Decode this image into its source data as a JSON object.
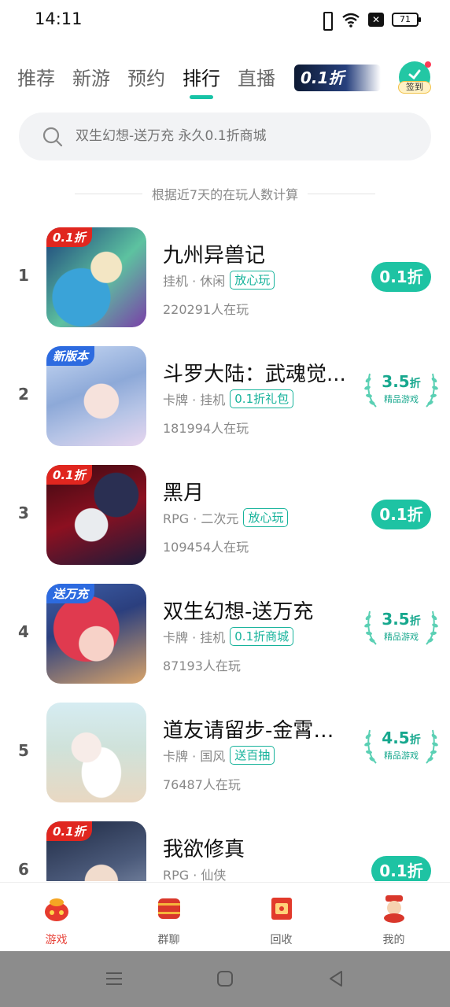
{
  "status_bar": {
    "time": "14:11",
    "battery": "71"
  },
  "tabs": [
    {
      "label": "推荐",
      "active": false
    },
    {
      "label": "新游",
      "active": false
    },
    {
      "label": "预约",
      "active": false
    },
    {
      "label": "排行",
      "active": true
    },
    {
      "label": "直播",
      "active": false
    }
  ],
  "promo_banner": {
    "text": "0.1折"
  },
  "signin": {
    "label": "签到"
  },
  "search": {
    "placeholder": "双生幻想-送万充 永久0.1折商城"
  },
  "ranking_note": "根据近7天的在玩人数计算",
  "games": [
    {
      "rank": "1",
      "title": "九州异兽记",
      "category": "挂机 · 休闲",
      "tag": "放心玩",
      "players": "220291人在玩",
      "badge": "0.1折",
      "badge_style": "red",
      "action": {
        "type": "button",
        "label": "0.1折"
      }
    },
    {
      "rank": "2",
      "title": "斗罗大陆：武魂觉...",
      "category": "卡牌 · 挂机",
      "tag": "0.1折礼包",
      "players": "181994人在玩",
      "badge": "新版本",
      "badge_style": "blue",
      "action": {
        "type": "quality",
        "value": "3.5",
        "unit": "折",
        "label": "精品游戏"
      }
    },
    {
      "rank": "3",
      "title": "黑月",
      "category": "RPG · 二次元",
      "tag": "放心玩",
      "players": "109454人在玩",
      "badge": "0.1折",
      "badge_style": "red",
      "action": {
        "type": "button",
        "label": "0.1折"
      }
    },
    {
      "rank": "4",
      "title": "双生幻想-送万充",
      "category": "卡牌 · 挂机",
      "tag": "0.1折商城",
      "players": "87193人在玩",
      "badge": "送万充",
      "badge_style": "blue",
      "action": {
        "type": "quality",
        "value": "3.5",
        "unit": "折",
        "label": "精品游戏"
      }
    },
    {
      "rank": "5",
      "title": "道友请留步-金霄破晓",
      "category": "卡牌 · 国风",
      "tag": "送百抽",
      "players": "76487人在玩",
      "badge": "",
      "badge_style": "none",
      "action": {
        "type": "quality",
        "value": "4.5",
        "unit": "折",
        "label": "精品游戏"
      }
    },
    {
      "rank": "6",
      "title": "我欲修真",
      "category": "RPG · 仙侠",
      "tag": "",
      "players": "",
      "badge": "0.1折",
      "badge_style": "red",
      "action": {
        "type": "button",
        "label": "0.1折"
      }
    }
  ],
  "bottom_nav": [
    {
      "label": "游戏",
      "active": true,
      "icon": "game-bag-icon"
    },
    {
      "label": "群聊",
      "active": false,
      "icon": "chat-drum-icon"
    },
    {
      "label": "回收",
      "active": false,
      "icon": "recycle-box-icon"
    },
    {
      "label": "我的",
      "active": false,
      "icon": "profile-mascot-icon"
    }
  ],
  "colors": {
    "accent": "#1ec3a3",
    "active_nav": "#e8453c"
  }
}
